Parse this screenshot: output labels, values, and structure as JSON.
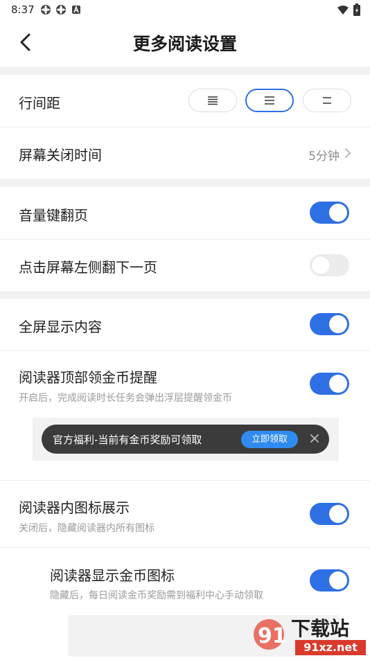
{
  "status_bar": {
    "time": "8:37",
    "left_icons": [
      "settings-gear-icon",
      "settings-gear-icon",
      "app-a-icon"
    ],
    "right_icons": [
      "wifi-icon",
      "battery-icon"
    ]
  },
  "header": {
    "title": "更多阅读设置",
    "back_icon": "chevron-left-icon"
  },
  "settings": {
    "line_spacing": {
      "label": "行间距",
      "options": [
        "tight-spacing-icon",
        "medium-spacing-icon",
        "wide-spacing-icon"
      ],
      "selected_index": 1
    },
    "screen_off": {
      "label": "屏幕关闭时间",
      "value": "5分钟"
    },
    "volume_page_turn": {
      "label": "音量键翻页",
      "enabled": true
    },
    "tap_left_next_page": {
      "label": "点击屏幕左侧翻下一页",
      "enabled": false
    },
    "fullscreen": {
      "label": "全屏显示内容",
      "enabled": true
    },
    "coin_reminder": {
      "label": "阅读器顶部领金币提醒",
      "description": "开启后，完成阅读时长任务会弹出浮层提醒领金币",
      "enabled": true,
      "banner": {
        "text": "官方福利-当前有金币奖励可领取",
        "button": "立即领取"
      }
    },
    "reader_icons": {
      "label": "阅读器内图标展示",
      "description": "关闭后，隐藏阅读器内所有图标",
      "enabled": true
    },
    "coin_icon": {
      "label": "阅读器显示金币图标",
      "description": "隐藏后，每日阅读金币奖励需到福利中心手动领取",
      "enabled": true
    }
  },
  "watermark": {
    "text": "下载站",
    "url_text": "91xz.net"
  },
  "colors": {
    "accent": "#2f6fe4",
    "section_gap": "#f2f2f2",
    "banner_bg": "#3b3b3b",
    "banner_button": "#2f8bf0"
  }
}
